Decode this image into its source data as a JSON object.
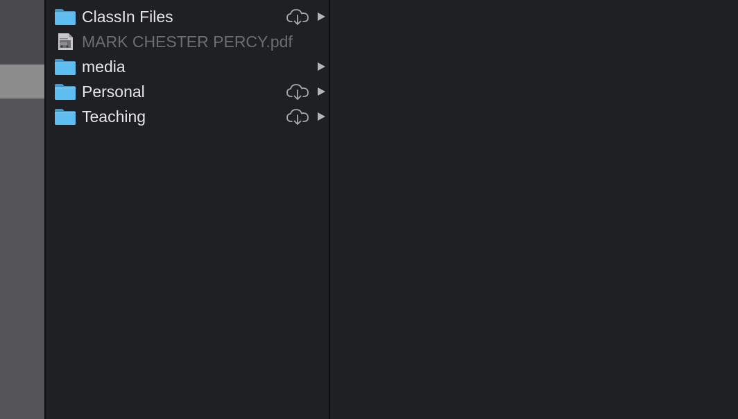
{
  "window": {
    "accent_folder_color": "#4fb3e8",
    "text_color": "#e6e6e6",
    "dimmed_text_color": "#6d6e72"
  },
  "column": {
    "items": [
      {
        "label": "ClassIn Files",
        "kind": "folder",
        "icon": "folder-icon",
        "cloud": true,
        "disclosure": true
      },
      {
        "label": "MARK CHESTER PERCY.pdf",
        "kind": "file",
        "icon": "pdf-document-icon",
        "cloud": false,
        "disclosure": false
      },
      {
        "label": "media",
        "kind": "folder",
        "icon": "folder-icon",
        "cloud": false,
        "disclosure": true
      },
      {
        "label": "Personal",
        "kind": "folder",
        "icon": "folder-icon",
        "cloud": true,
        "disclosure": true
      },
      {
        "label": "Teaching",
        "kind": "folder",
        "icon": "folder-icon",
        "cloud": true,
        "disclosure": true
      }
    ]
  }
}
